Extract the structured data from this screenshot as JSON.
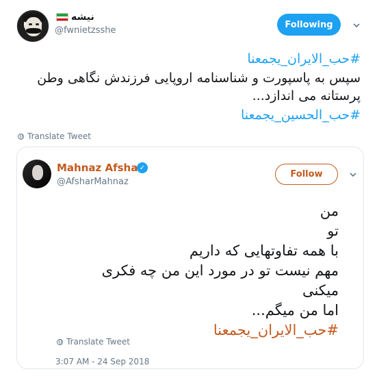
{
  "author": {
    "name": "نیشه",
    "handle": "@fwnietzsshe",
    "follow_label": "Following"
  },
  "tweet": {
    "hashtag_top": "#حب_الایران_یجمعنا",
    "line1": "سپس به پاسپورت و شناسنامه اروپایی فرزندش نگاهی وطن",
    "line2": "پرستانه می اندازد...",
    "hashtag_bottom": "#حب_الحسین_یجمعنا",
    "translate_label": "Translate Tweet"
  },
  "quoted": {
    "name": "Mahnaz Afshar",
    "handle": "@AfsharMahnaz",
    "follow_label": "Follow",
    "lines": [
      "من",
      "تو",
      "با همه تفاوتهایی که داریم",
      "مهم نیست تو در مورد این من چه فکری",
      "میکنی",
      "اما من میگم..."
    ],
    "hashtag": "#حب_الایران_یجمعنا",
    "translate_label": "Translate Tweet",
    "timestamp": "3:07 AM - 24 Sep 2018"
  },
  "colors": {
    "accent": "#1da1f2",
    "quote_accent": "#c35a1e"
  },
  "icons": [
    "flag-iran-icon",
    "chevron-down-icon",
    "globe-icon",
    "verified-icon"
  ]
}
